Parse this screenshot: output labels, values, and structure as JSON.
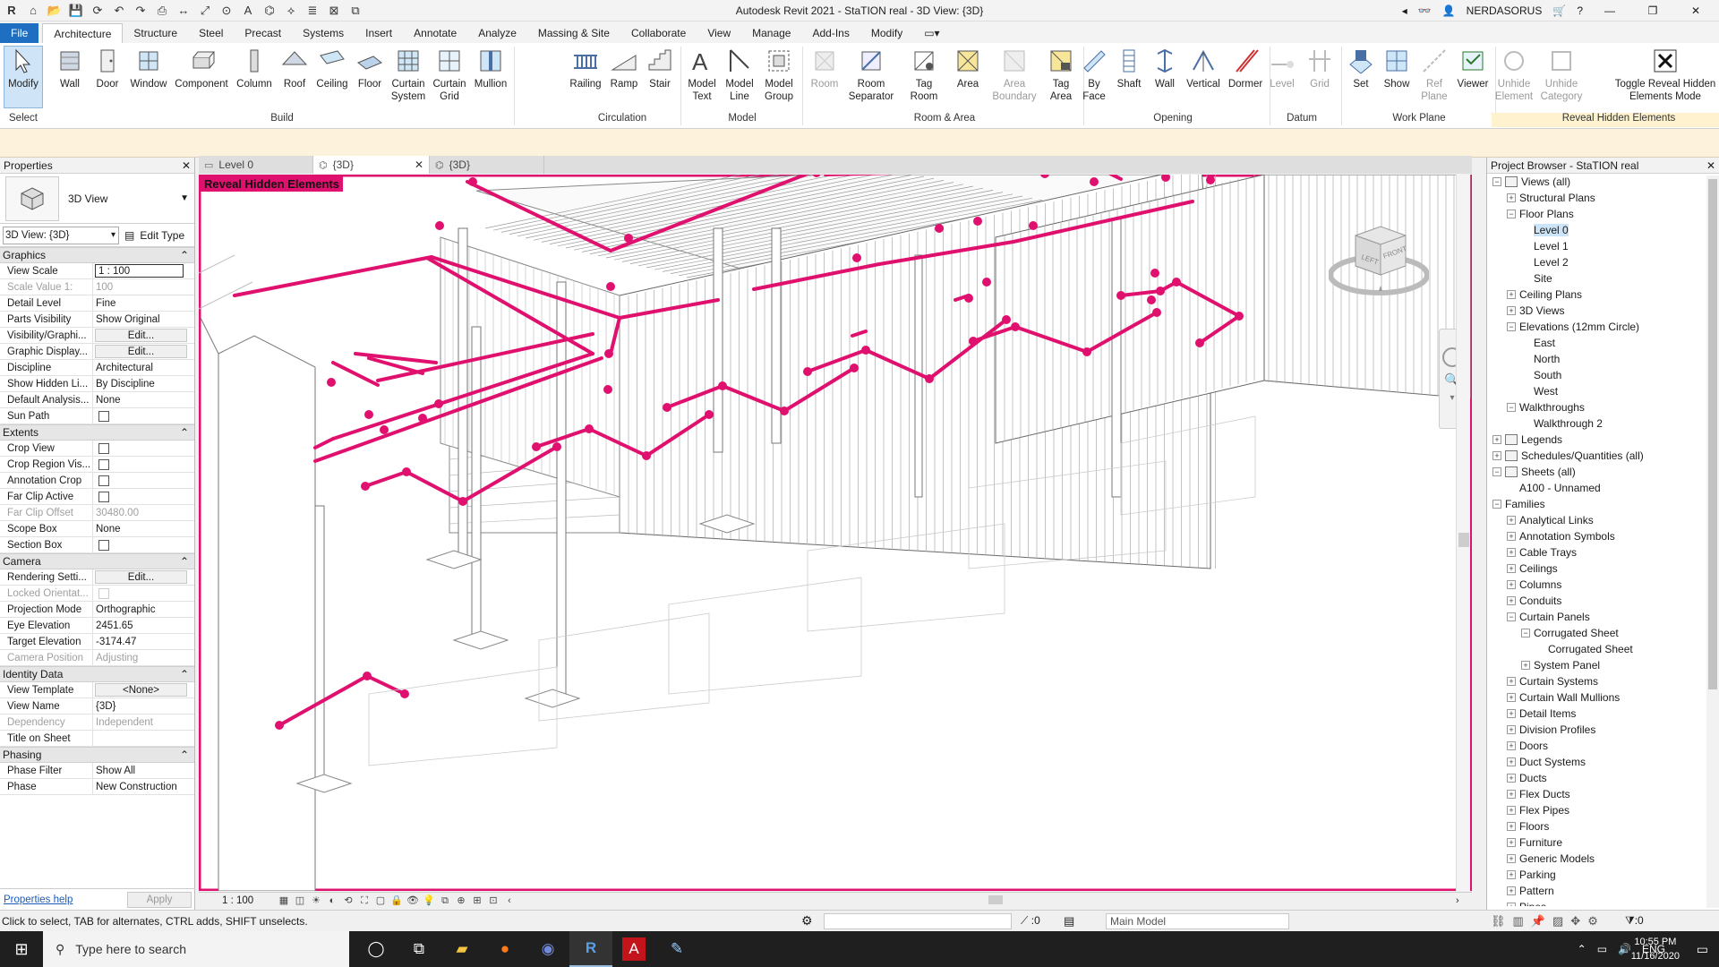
{
  "app": {
    "title": "Autodesk Revit 2021 - StaTION real - 3D View: {3D}",
    "user": "NERDASORUS",
    "qat_icons": [
      "revit-logo-icon",
      "open-icon",
      "save-icon",
      "sync-icon",
      "undo-icon",
      "redo-icon",
      "print-icon",
      "measure-icon",
      "dimension-icon",
      "tag-icon",
      "text-icon",
      "3d-view-icon",
      "section-icon",
      "thin-lines-icon",
      "close-hidden-icon",
      "switch-windows-icon"
    ]
  },
  "ribbon_tabs": [
    "File",
    "Architecture",
    "Structure",
    "Steel",
    "Precast",
    "Systems",
    "Insert",
    "Annotate",
    "Analyze",
    "Massing & Site",
    "Collaborate",
    "View",
    "Manage",
    "Add-Ins",
    "Modify"
  ],
  "ribbon_active_tab": "Architecture",
  "ribbon": {
    "modify": "Modify",
    "select_label": "Select",
    "build": {
      "label": "Build",
      "tools": [
        "Wall",
        "Door",
        "Window",
        "Component",
        "Column",
        "Roof",
        "Ceiling",
        "Floor",
        "Curtain\nSystem",
        "Curtain\nGrid",
        "Mullion"
      ]
    },
    "circulation": {
      "label": "Circulation",
      "tools": [
        "Railing",
        "Ramp",
        "Stair"
      ]
    },
    "model": {
      "label": "Model",
      "tools": [
        "Model\nText",
        "Model\nLine",
        "Model\nGroup"
      ]
    },
    "room_area": {
      "label": "Room & Area",
      "tools": [
        "Room",
        "Room\nSeparator",
        "Tag\nRoom",
        "Area",
        "Area\nBoundary",
        "Tag\nArea"
      ]
    },
    "opening": {
      "label": "Opening",
      "tools": [
        "By\nFace",
        "Shaft",
        "Wall",
        "Vertical",
        "Dormer"
      ]
    },
    "datum": {
      "label": "Datum",
      "tools": [
        "Level",
        "Grid"
      ]
    },
    "work_plane": {
      "label": "Work Plane",
      "tools": [
        "Set",
        "Show",
        "Ref\nPlane",
        "Viewer"
      ]
    },
    "reveal": {
      "label": "Reveal Hidden Elements",
      "tools": [
        "Unhide\nElement",
        "Unhide\nCategory",
        "Toggle Reveal Hidden\nElements Mode"
      ]
    }
  },
  "properties": {
    "title": "Properties",
    "type_name": "3D View",
    "instance_selector": "3D View: {3D}",
    "edit_type": "Edit Type",
    "groups": [
      {
        "name": "Graphics",
        "rows": [
          {
            "k": "View Scale",
            "v": "1 : 100",
            "style": "input"
          },
          {
            "k": "Scale Value    1:",
            "v": "100",
            "style": "dim"
          },
          {
            "k": "Detail Level",
            "v": "Fine"
          },
          {
            "k": "Parts Visibility",
            "v": "Show Original"
          },
          {
            "k": "Visibility/Graphi...",
            "v": "Edit...",
            "style": "btn"
          },
          {
            "k": "Graphic Display...",
            "v": "Edit...",
            "style": "btn"
          },
          {
            "k": "Discipline",
            "v": "Architectural"
          },
          {
            "k": "Show Hidden Li...",
            "v": "By Discipline"
          },
          {
            "k": "Default Analysis...",
            "v": "None"
          },
          {
            "k": "Sun Path",
            "v": "",
            "style": "check"
          }
        ]
      },
      {
        "name": "Extents",
        "rows": [
          {
            "k": "Crop View",
            "v": "",
            "style": "check"
          },
          {
            "k": "Crop Region Vis...",
            "v": "",
            "style": "check"
          },
          {
            "k": "Annotation Crop",
            "v": "",
            "style": "check"
          },
          {
            "k": "Far Clip Active",
            "v": "",
            "style": "check"
          },
          {
            "k": "Far Clip Offset",
            "v": "30480.00",
            "style": "dim"
          },
          {
            "k": "Scope Box",
            "v": "None"
          },
          {
            "k": "Section Box",
            "v": "",
            "style": "check"
          }
        ]
      },
      {
        "name": "Camera",
        "rows": [
          {
            "k": "Rendering Setti...",
            "v": "Edit...",
            "style": "btn"
          },
          {
            "k": "Locked Orientat...",
            "v": "",
            "style": "dimcheck"
          },
          {
            "k": "Projection Mode",
            "v": "Orthographic"
          },
          {
            "k": "Eye Elevation",
            "v": "2451.65"
          },
          {
            "k": "Target Elevation",
            "v": "-3174.47"
          },
          {
            "k": "Camera Position",
            "v": "Adjusting",
            "style": "dim"
          }
        ]
      },
      {
        "name": "Identity Data",
        "rows": [
          {
            "k": "View Template",
            "v": "<None>",
            "style": "btn"
          },
          {
            "k": "View Name",
            "v": "{3D}"
          },
          {
            "k": "Dependency",
            "v": "Independent",
            "style": "dim"
          },
          {
            "k": "Title on Sheet",
            "v": ""
          }
        ]
      },
      {
        "name": "Phasing",
        "rows": [
          {
            "k": "Phase Filter",
            "v": "Show All"
          },
          {
            "k": "Phase",
            "v": "New Construction"
          }
        ]
      }
    ],
    "help": "Properties help",
    "apply": "Apply"
  },
  "view_tabs": [
    {
      "label": "Level 0",
      "active": false
    },
    {
      "label": "{3D}",
      "active": true
    },
    {
      "label": "{3D}",
      "active": false
    }
  ],
  "canvas": {
    "reveal_label": "Reveal Hidden Elements",
    "viewcube_left": "LEFT",
    "viewcube_front": "FRONT",
    "highlight_color": "#e0106e"
  },
  "view_control": {
    "scale": "1 : 100"
  },
  "browser": {
    "title": "Project Browser - StaTION real",
    "items": [
      {
        "label": "Views (all)",
        "indent": 0,
        "tog": "−",
        "icon": true
      },
      {
        "label": "Structural Plans",
        "indent": 1,
        "tog": "+"
      },
      {
        "label": "Floor Plans",
        "indent": 1,
        "tog": "−"
      },
      {
        "label": "Level 0",
        "indent": 2,
        "sel": true
      },
      {
        "label": "Level 1",
        "indent": 2
      },
      {
        "label": "Level 2",
        "indent": 2
      },
      {
        "label": "Site",
        "indent": 2
      },
      {
        "label": "Ceiling Plans",
        "indent": 1,
        "tog": "+"
      },
      {
        "label": "3D Views",
        "indent": 1,
        "tog": "+"
      },
      {
        "label": "Elevations (12mm Circle)",
        "indent": 1,
        "tog": "−"
      },
      {
        "label": "East",
        "indent": 2
      },
      {
        "label": "North",
        "indent": 2
      },
      {
        "label": "South",
        "indent": 2
      },
      {
        "label": "West",
        "indent": 2
      },
      {
        "label": "Walkthroughs",
        "indent": 1,
        "tog": "−"
      },
      {
        "label": "Walkthrough 2",
        "indent": 2
      },
      {
        "label": "Legends",
        "indent": 0,
        "tog": "+",
        "icon": true
      },
      {
        "label": "Schedules/Quantities (all)",
        "indent": 0,
        "tog": "+",
        "icon": true
      },
      {
        "label": "Sheets (all)",
        "indent": 0,
        "tog": "−",
        "icon": true
      },
      {
        "label": "A100 - Unnamed",
        "indent": 1
      },
      {
        "label": "Families",
        "indent": 0,
        "tog": "−"
      },
      {
        "label": "Analytical Links",
        "indent": 1,
        "tog": "+"
      },
      {
        "label": "Annotation Symbols",
        "indent": 1,
        "tog": "+"
      },
      {
        "label": "Cable Trays",
        "indent": 1,
        "tog": "+"
      },
      {
        "label": "Ceilings",
        "indent": 1,
        "tog": "+"
      },
      {
        "label": "Columns",
        "indent": 1,
        "tog": "+"
      },
      {
        "label": "Conduits",
        "indent": 1,
        "tog": "+"
      },
      {
        "label": "Curtain Panels",
        "indent": 1,
        "tog": "−"
      },
      {
        "label": "Corrugated Sheet",
        "indent": 2,
        "tog": "−"
      },
      {
        "label": "Corrugated Sheet",
        "indent": 3
      },
      {
        "label": "System Panel",
        "indent": 2,
        "tog": "+"
      },
      {
        "label": "Curtain Systems",
        "indent": 1,
        "tog": "+"
      },
      {
        "label": "Curtain Wall Mullions",
        "indent": 1,
        "tog": "+"
      },
      {
        "label": "Detail Items",
        "indent": 1,
        "tog": "+"
      },
      {
        "label": "Division Profiles",
        "indent": 1,
        "tog": "+"
      },
      {
        "label": "Doors",
        "indent": 1,
        "tog": "+"
      },
      {
        "label": "Duct Systems",
        "indent": 1,
        "tog": "+"
      },
      {
        "label": "Ducts",
        "indent": 1,
        "tog": "+"
      },
      {
        "label": "Flex Ducts",
        "indent": 1,
        "tog": "+"
      },
      {
        "label": "Flex Pipes",
        "indent": 1,
        "tog": "+"
      },
      {
        "label": "Floors",
        "indent": 1,
        "tog": "+"
      },
      {
        "label": "Furniture",
        "indent": 1,
        "tog": "+"
      },
      {
        "label": "Generic Models",
        "indent": 1,
        "tog": "+"
      },
      {
        "label": "Parking",
        "indent": 1,
        "tog": "+"
      },
      {
        "label": "Pattern",
        "indent": 1,
        "tog": "+"
      },
      {
        "label": "Pipes",
        "indent": 1,
        "tog": "+"
      }
    ]
  },
  "status": {
    "message": "Click to select, TAB for alternates, CTRL adds, SHIFT unselects.",
    "count": ":0",
    "model": "Main Model",
    "filter": ":0"
  },
  "taskbar": {
    "search_placeholder": "Type here to search",
    "lang": "ENG",
    "time": "10:55 PM",
    "date": "11/16/2020"
  }
}
